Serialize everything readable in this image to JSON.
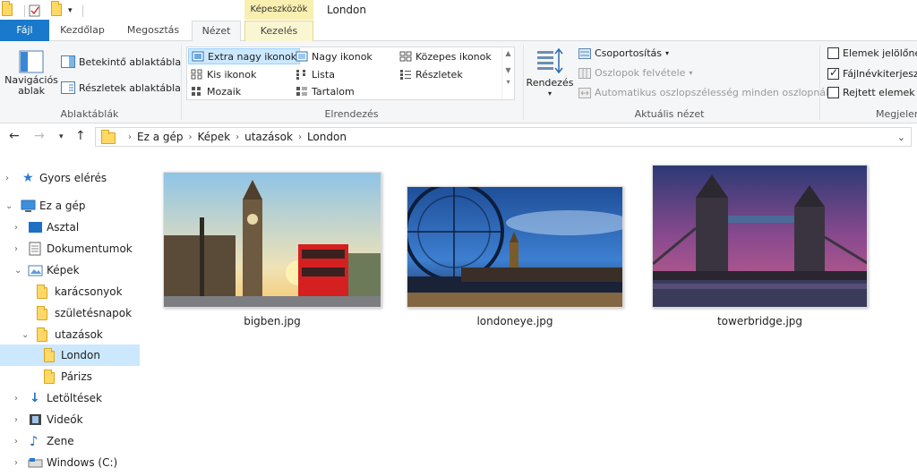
{
  "window": {
    "title": "London",
    "context_tab_group": "Képeszközök"
  },
  "tabs": {
    "file": "Fájl",
    "home": "Kezdőlap",
    "share": "Megosztás",
    "view": "Nézet",
    "manage": "Kezelés"
  },
  "ribbon": {
    "panes": {
      "label": "Ablaktáblák",
      "navigation_pane": "Navigációs ablak",
      "preview_pane": "Betekintő ablaktábla",
      "details_pane": "Részletek ablaktábla"
    },
    "layout": {
      "label": "Elrendezés",
      "extra_large_icons": "Extra nagy ikonok",
      "large_icons": "Nagy ikonok",
      "medium_icons": "Közepes ikonok",
      "small_icons": "Kis ikonok",
      "list": "Lista",
      "details": "Részletek",
      "tiles": "Mozaik",
      "content": "Tartalom",
      "selected": "Extra nagy ikonok"
    },
    "current_view": {
      "label": "Aktuális nézet",
      "sort_by": "Rendezés",
      "group_by": "Csoportosítás",
      "add_columns": "Oszlopok felvétele",
      "size_columns": "Automatikus oszlopszélesség minden oszlopnál"
    },
    "show_hide": {
      "label": "Megjeler",
      "item_checkboxes": "Elemek jelölőné",
      "file_extensions": "Fájlnévkiterjeszt",
      "hidden_items": "Rejtett elemek",
      "item_checkboxes_checked": false,
      "file_extensions_checked": true,
      "hidden_items_checked": false
    }
  },
  "breadcrumb": [
    "Ez a gép",
    "Képek",
    "utazások",
    "London"
  ],
  "sidebar": {
    "quick_access": "Gyors elérés",
    "this_pc": "Ez a gép",
    "desktop": "Asztal",
    "documents": "Dokumentumok",
    "pictures": "Képek",
    "christmas": "karácsonyok",
    "birthdays": "születésnapok",
    "travels": "utazások",
    "london": "London",
    "paris": "Párizs",
    "downloads": "Letöltések",
    "videos": "Videók",
    "music": "Zene",
    "windows_drive": "Windows (C:)"
  },
  "files": [
    {
      "name": "bigben.jpg"
    },
    {
      "name": "londoneye.jpg"
    },
    {
      "name": "towerbridge.jpg"
    }
  ],
  "colors": {
    "accent": "#1979ca",
    "selection": "#cce8ff",
    "folder": "#ffd966"
  }
}
